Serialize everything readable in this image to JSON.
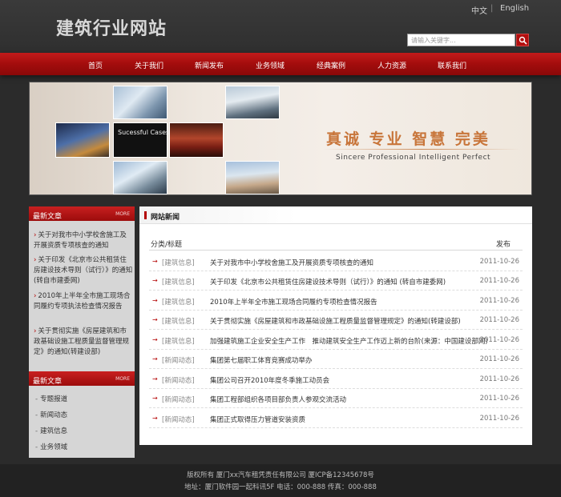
{
  "header": {
    "site_title": "建筑行业网站",
    "lang_cn": "中文",
    "lang_sep": "|",
    "lang_en": "English",
    "search_placeholder": "请输入关键字..."
  },
  "nav": {
    "items": [
      "首页",
      "关于我们",
      "新闻发布",
      "业务领域",
      "经典案例",
      "人力资源",
      "联系我们"
    ]
  },
  "banner": {
    "cases_label": "Sucessful Cases",
    "slogan_cn": "真诚 专业 智慧 完美",
    "slogan_en": "Sincere Professional Intelligent Perfect"
  },
  "sidebar": {
    "latest_title": "最新文章",
    "more_label": "MORE",
    "latest_items": [
      "关于对我市中小学校舍施工及开展资质专项核查的通知",
      "关于印发《北京市公共租赁住房建设技术导则（试行）》的通知 (转自市建委网)",
      "2010年上半年全市施工现场合同履约专项执法检查情况报告",
      "关于贯彻实施《房屋建筑和市政基础设施工程质量监督管理规定》的通知(转建设部)"
    ],
    "second_title": "最新文章",
    "second_more": "MORE",
    "links": [
      "专题报道",
      "新闻动态",
      "建筑信息",
      "业务领域"
    ]
  },
  "main": {
    "tab_title": "网站新闻",
    "col_category": "分类/标题",
    "col_date": "发布",
    "rows": [
      {
        "cat": "[建筑信息]",
        "title": "关于对我市中小学校舍施工及开展资质专项核查的通知",
        "date": "2011-10-26"
      },
      {
        "cat": "[建筑信息]",
        "title": "关于印发《北京市公共租赁住房建设技术导则（试行）》的通知 (转自市建委网)",
        "date": "2011-10-26"
      },
      {
        "cat": "[建筑信息]",
        "title": "2010年上半年全市施工现场合同履约专项检查情况报告",
        "date": "2011-10-26"
      },
      {
        "cat": "[建筑信息]",
        "title": "关于贯彻实施《房屋建筑和市政基础设施工程质量监督管理规定》的通知(转建设部)",
        "date": "2011-10-26"
      },
      {
        "cat": "[建筑信息]",
        "title": "加强建筑施工企业安全生产工作　推动建筑安全生产工作迈上新的台阶(来源：中国建设部网)",
        "date": "2011-10-26"
      },
      {
        "cat": "[新闻动态]",
        "title": "集团第七届职工体育竞赛成功举办",
        "date": "2011-10-26"
      },
      {
        "cat": "[新闻动态]",
        "title": "集团公司召开2010年度冬季施工动员会",
        "date": "2011-10-26"
      },
      {
        "cat": "[新闻动态]",
        "title": "集团工程部组织各项目部负责人参观交流活动",
        "date": "2011-10-26"
      },
      {
        "cat": "[新闻动态]",
        "title": "集团正式取得压力管道安装资质",
        "date": "2011-10-26"
      }
    ]
  },
  "footer": {
    "line1": "版权所有 厦门xx汽车租凭责任有限公司 厦ICP备12345678号",
    "line2": "地址：厦门软件园一起科讯5F 电话：000-888 传真：000-888"
  }
}
